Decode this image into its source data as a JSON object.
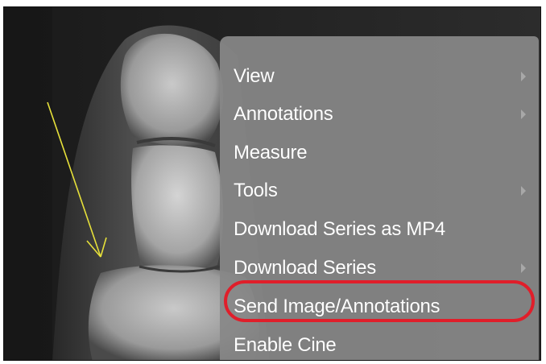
{
  "menu": {
    "items": [
      {
        "label": "View",
        "has_submenu": true
      },
      {
        "label": "Annotations",
        "has_submenu": true
      },
      {
        "label": "Measure",
        "has_submenu": false
      },
      {
        "label": "Tools",
        "has_submenu": true
      },
      {
        "label": "Download Series as MP4",
        "has_submenu": false
      },
      {
        "label": "Download Series",
        "has_submenu": true
      },
      {
        "label": "Send Image/Annotations",
        "has_submenu": false,
        "highlighted": true
      },
      {
        "label": "Enable Cine",
        "has_submenu": false
      }
    ]
  },
  "colors": {
    "menu_background": "#888888",
    "menu_text": "#ffffff",
    "highlight_ring": "#e01e2a",
    "annotation_arrow": "#e6e03a"
  },
  "annotation": {
    "icon": "arrow-annotation-icon"
  }
}
